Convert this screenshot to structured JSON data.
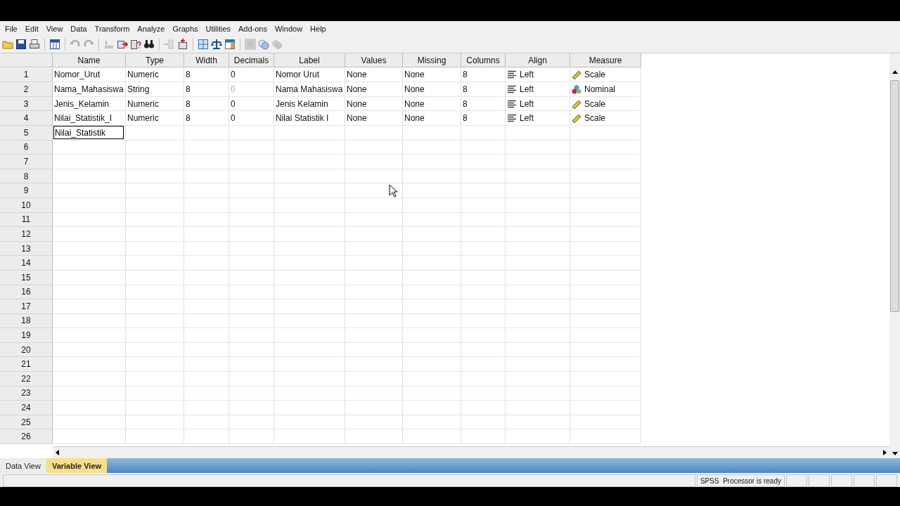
{
  "menu": [
    "File",
    "Edit",
    "View",
    "Data",
    "Transform",
    "Analyze",
    "Graphs",
    "Utilities",
    "Add-ons",
    "Window",
    "Help"
  ],
  "toolbar": [
    {
      "kind": "folder",
      "disabled": false
    },
    {
      "kind": "save",
      "disabled": false
    },
    {
      "kind": "printer",
      "disabled": false
    },
    {
      "kind": "sep"
    },
    {
      "kind": "table",
      "disabled": false
    },
    {
      "kind": "sep"
    },
    {
      "kind": "undo",
      "disabled": true
    },
    {
      "kind": "redo",
      "disabled": true
    },
    {
      "kind": "sep"
    },
    {
      "kind": "goto-row",
      "disabled": true
    },
    {
      "kind": "goto-case",
      "disabled": false
    },
    {
      "kind": "variables",
      "disabled": false
    },
    {
      "kind": "binoculars",
      "disabled": false
    },
    {
      "kind": "sep"
    },
    {
      "kind": "insert-row",
      "disabled": true
    },
    {
      "kind": "insert-column",
      "disabled": false
    },
    {
      "kind": "sep"
    },
    {
      "kind": "split",
      "disabled": false
    },
    {
      "kind": "balance",
      "disabled": false
    },
    {
      "kind": "select",
      "disabled": false
    },
    {
      "kind": "sep"
    },
    {
      "kind": "labels",
      "disabled": true
    },
    {
      "kind": "circles",
      "disabled": false
    },
    {
      "kind": "circles2",
      "disabled": true
    }
  ],
  "table": {
    "columns": [
      "Name",
      "Type",
      "Width",
      "Decimals",
      "Label",
      "Values",
      "Missing",
      "Columns",
      "Align",
      "Measure"
    ],
    "rows": [
      {
        "number": "1",
        "cells": [
          "Nomor_Urut",
          "Numeric",
          "8",
          "0",
          "Nomor Urut",
          "None",
          "None",
          "8"
        ],
        "decimals_disabled": false,
        "align": "Left",
        "measure": {
          "kind": "scale",
          "text": "Scale"
        }
      },
      {
        "number": "2",
        "cells": [
          "Nama_Mahasiswa",
          "String",
          "8",
          "0",
          "Nama Mahasiswa",
          "None",
          "None",
          "8"
        ],
        "decimals_disabled": true,
        "align": "Left",
        "measure": {
          "kind": "nominal",
          "text": "Nominal"
        }
      },
      {
        "number": "3",
        "cells": [
          "Jenis_Kelamin",
          "Numeric",
          "8",
          "0",
          "Jenis Kelamin",
          "None",
          "None",
          "8"
        ],
        "decimals_disabled": false,
        "align": "Left",
        "measure": {
          "kind": "scale",
          "text": "Scale"
        }
      },
      {
        "number": "4",
        "cells": [
          "Nilai_Statistik_I",
          "Numeric",
          "8",
          "0",
          "Nilai Statistik I",
          "None",
          "None",
          "8"
        ],
        "decimals_disabled": false,
        "align": "Left",
        "measure": {
          "kind": "scale",
          "text": "Scale"
        }
      },
      {
        "number": "5",
        "editing": "Nilai_Statistik"
      },
      {
        "number": "6"
      },
      {
        "number": "7"
      },
      {
        "number": "8"
      },
      {
        "number": "9"
      },
      {
        "number": "10"
      },
      {
        "number": "11"
      },
      {
        "number": "12"
      },
      {
        "number": "13"
      },
      {
        "number": "14"
      },
      {
        "number": "15"
      },
      {
        "number": "16"
      },
      {
        "number": "17"
      },
      {
        "number": "18"
      },
      {
        "number": "19"
      },
      {
        "number": "20"
      },
      {
        "number": "21"
      },
      {
        "number": "22"
      },
      {
        "number": "23"
      },
      {
        "number": "24"
      },
      {
        "number": "25"
      },
      {
        "number": "26"
      }
    ]
  },
  "tabs": [
    {
      "label": "Data View",
      "selected": false
    },
    {
      "label": "Variable View",
      "selected": true
    }
  ],
  "status_bar": {
    "message": "SPSS  Processor is ready"
  }
}
